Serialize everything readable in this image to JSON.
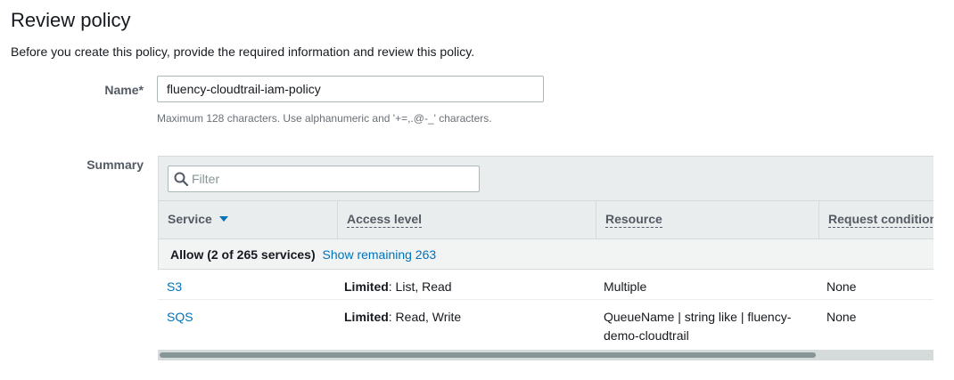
{
  "page": {
    "title": "Review policy",
    "intro": "Before you create this policy, provide the required information and review this policy."
  },
  "name_field": {
    "label": "Name*",
    "value": "fluency-cloudtrail-iam-policy",
    "hint": "Maximum 128 characters. Use alphanumeric and '+=,.@-_' characters."
  },
  "summary": {
    "label": "Summary",
    "filter_placeholder": "Filter",
    "columns": [
      "Service",
      "Access level",
      "Resource",
      "Request condition"
    ],
    "group": {
      "text": "Allow (2 of 265 services)",
      "link": "Show remaining 263"
    },
    "rows": [
      {
        "service": "S3",
        "access_bold": "Limited",
        "access_rest": ": List, Read",
        "resource": "Multiple",
        "request": "None"
      },
      {
        "service": "SQS",
        "access_bold": "Limited",
        "access_rest": ": Read, Write",
        "resource": "QueueName | string like | fluency-demo-cloudtrail",
        "request": "None"
      }
    ],
    "scroll_fraction": 0.85
  },
  "colors": {
    "link": "#0073bb",
    "header_bg": "#eaeded",
    "label": "#545b64"
  },
  "icons": [
    "search-icon",
    "sort-down-icon"
  ]
}
